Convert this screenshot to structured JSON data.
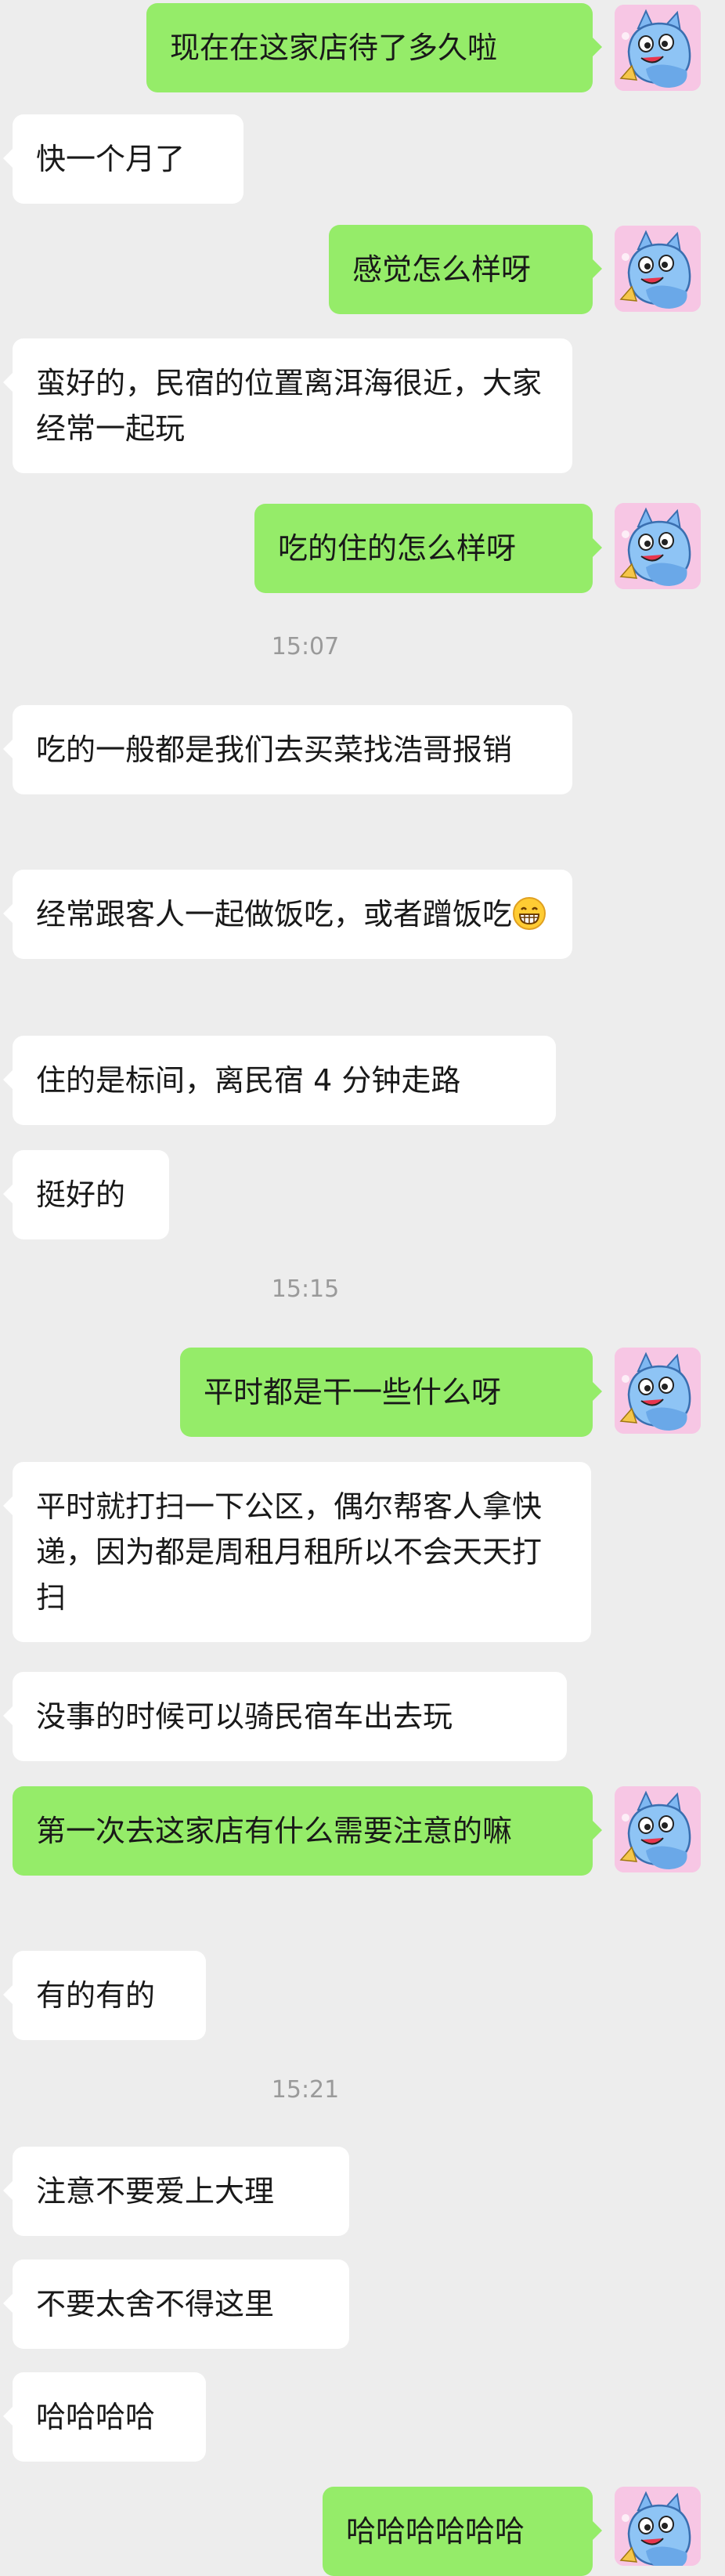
{
  "messages": [
    {
      "type": "out",
      "text": "现在在这家店待了多久啦"
    },
    {
      "type": "in",
      "text": "快一个月了"
    },
    {
      "type": "out",
      "text": "感觉怎么样呀"
    },
    {
      "type": "in",
      "text": "蛮好的，民宿的位置离洱海很近，大家经常一起玩"
    },
    {
      "type": "out",
      "text": "吃的住的怎么样呀"
    },
    {
      "type": "time",
      "text": "15:07"
    },
    {
      "type": "in",
      "text": "吃的一般都是我们去买菜找浩哥报销"
    },
    {
      "type": "in",
      "text": "经常跟客人一起做饭吃，或者蹭饭吃"
    },
    {
      "type": "in",
      "text": "住的是标间，离民宿 4 分钟走路"
    },
    {
      "type": "in",
      "text": "挺好的"
    },
    {
      "type": "time",
      "text": "15:15"
    },
    {
      "type": "out",
      "text": "平时都是干一些什么呀"
    },
    {
      "type": "in",
      "text": "平时就打扫一下公区，偶尔帮客人拿快递，因为都是周租月租所以不会天天打扫"
    },
    {
      "type": "in",
      "text": "没事的时候可以骑民宿车出去玩"
    },
    {
      "type": "out",
      "text": "第一次去这家店有什么需要注意的嘛"
    },
    {
      "type": "in",
      "text": "有的有的"
    },
    {
      "type": "time",
      "text": "15:21"
    },
    {
      "type": "in",
      "text": "注意不要爱上大理"
    },
    {
      "type": "in",
      "text": "不要太舍不得这里"
    },
    {
      "type": "in",
      "text": "哈哈哈哈"
    },
    {
      "type": "out",
      "text": "哈哈哈哈哈哈"
    }
  ],
  "colors": {
    "out_bubble": "#95ec69",
    "in_bubble": "#ffffff",
    "background": "#ededed"
  },
  "icons": {
    "avatar": "cartoon-avatar-icon",
    "emoji": "grinning-face-emoji"
  }
}
